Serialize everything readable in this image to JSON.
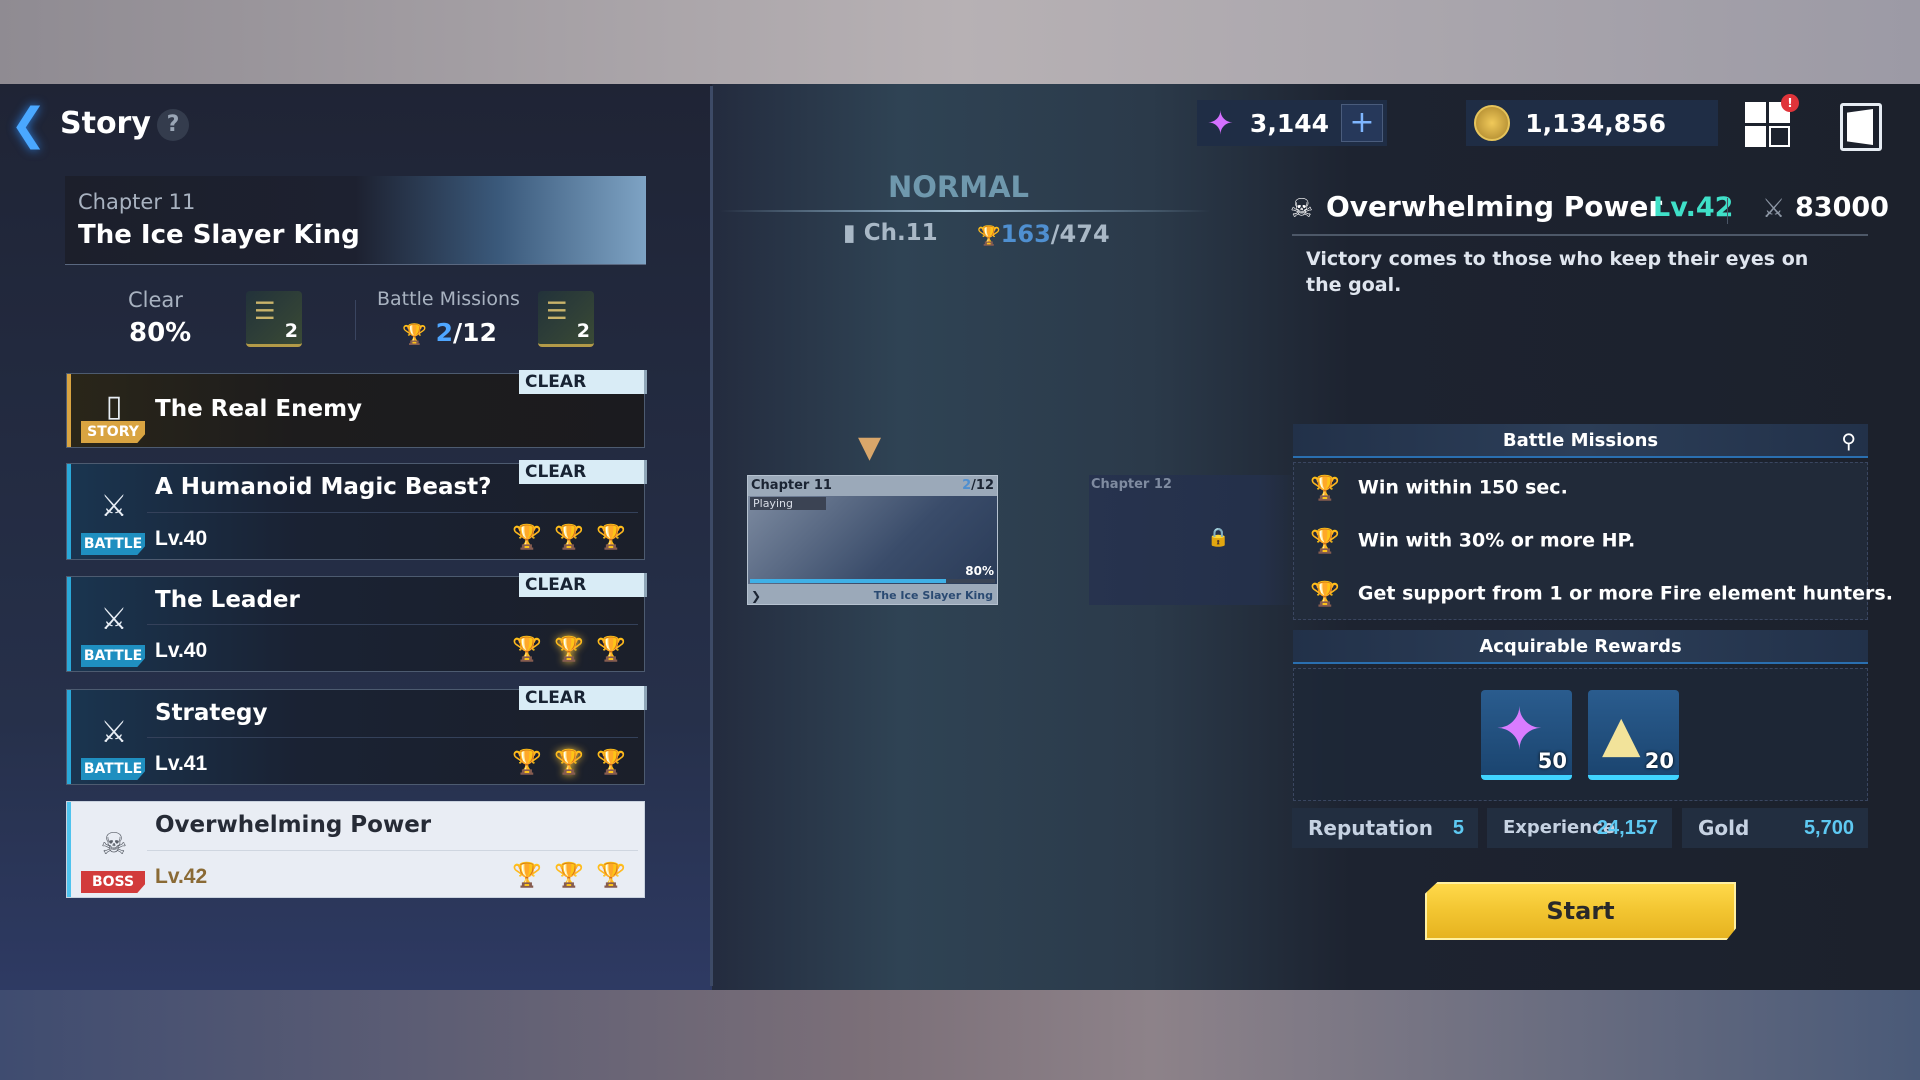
{
  "header": {
    "title": "Story",
    "help": "?"
  },
  "chapter": {
    "label": "Chapter 11",
    "title": "The Ice Slayer King"
  },
  "stats": {
    "clear_label": "Clear",
    "clear_value": "80%",
    "clear_reward_qty": "2",
    "missions_label": "Battle Missions",
    "missions_done": "2",
    "missions_total": "/12",
    "missions_reward_qty": "2"
  },
  "stages": [
    {
      "type": "STORY",
      "name": "The Real Enemy",
      "status": "CLEAR"
    },
    {
      "type": "BATTLE",
      "name": "A Humanoid Magic Beast?",
      "level": "Lv.40",
      "status": "CLEAR",
      "trophies": [
        false,
        false,
        false
      ]
    },
    {
      "type": "BATTLE",
      "name": "The Leader",
      "level": "Lv.40",
      "status": "CLEAR",
      "trophies": [
        false,
        true,
        false
      ]
    },
    {
      "type": "BATTLE",
      "name": "Strategy",
      "level": "Lv.41",
      "status": "CLEAR",
      "trophies": [
        false,
        true,
        false
      ]
    },
    {
      "type": "BOSS",
      "name": "Overwhelming Power",
      "level": "Lv.42",
      "selected": true,
      "trophies": [
        false,
        false,
        false
      ]
    }
  ],
  "map": {
    "difficulty": "NORMAL",
    "chapter": "Ch.11",
    "trophies_done": "163",
    "trophies_total": "/474",
    "chapters": [
      {
        "label": "Chapter 11",
        "trophies_done": "2",
        "trophies_total": "/12",
        "status": "Playing",
        "progress": 80,
        "progress_label": "80%",
        "title": "The Ice Slayer King"
      },
      {
        "label": "Chapter 12",
        "locked": true
      }
    ]
  },
  "currency": {
    "gems": "3,144",
    "gold": "1,134,856",
    "notification": "!"
  },
  "detail": {
    "title": "Overwhelming Power",
    "level": "Lv.42",
    "power": "83000",
    "description": "Victory comes to those who keep their eyes on the goal.",
    "missions_header": "Battle Missions",
    "missions": [
      "Win within 150 sec.",
      "Win with 30% or more HP.",
      "Get support from 1 or more Fire element hunters."
    ],
    "rewards_header": "Acquirable Rewards",
    "rewards": [
      {
        "icon": "gem-icon",
        "qty": "50"
      },
      {
        "icon": "gold-dust-icon",
        "qty": "20"
      }
    ],
    "reputation_label": "Reputation",
    "reputation": "5",
    "experience_label": "Experience",
    "experience": "24,157",
    "gold_label": "Gold",
    "gold": "5,700",
    "start": "Start"
  },
  "colors": {
    "accent_blue": "#2aa8d8",
    "level_green": "#3fe0c8",
    "start_yellow": "#f2c531",
    "boss_red": "#d23b3b",
    "story_gold": "#d9a441"
  }
}
